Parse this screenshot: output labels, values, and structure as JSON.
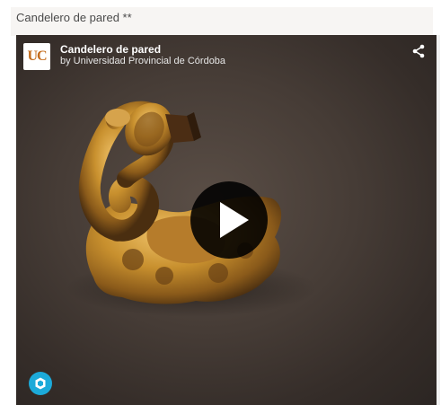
{
  "embed": {
    "title": "Candelero de pared **"
  },
  "viewer": {
    "logo_text": "UC",
    "model_title": "Candelero de pared",
    "model_author": "by Universidad Provincial de Córdoba",
    "share_icon": "share-icon",
    "play_icon": "play-icon",
    "brand_icon": "sketchfab-logo-icon"
  },
  "colors": {
    "gold": "#c8902e",
    "background": "#3f3631",
    "brand_blue": "#1caad9"
  }
}
